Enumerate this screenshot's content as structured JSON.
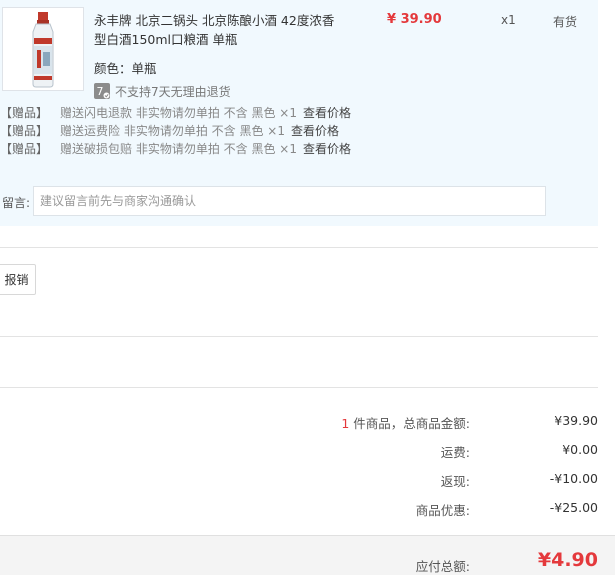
{
  "item": {
    "title": "永丰牌 北京二锅头 北京陈酿小酒 42度浓香型白酒150ml口粮酒 单瓶",
    "price": "¥ 39.90",
    "quantity": "x1",
    "stock": "有货",
    "color": "颜色：单瓶",
    "return_icon_text": "7",
    "return_policy": "不支持7天无理由退货"
  },
  "gifts": [
    {
      "tag": "【赠品】",
      "desc": "赠送闪电退款 非实物请勿单拍 不含 黑色 ×1",
      "link": "查看价格"
    },
    {
      "tag": "【赠品】",
      "desc": "赠送运费险 非实物请勿单拍 不含 黑色 ×1",
      "link": "查看价格"
    },
    {
      "tag": "【赠品】",
      "desc": "赠送破损包赔 非实物请勿单拍 不含 黑色 ×1",
      "link": "查看价格"
    }
  ],
  "note": {
    "label": "留言:",
    "placeholder": "建议留言前先与商家沟通确认"
  },
  "invoice": {
    "button_label": "报销"
  },
  "summary": {
    "count": "1",
    "count_suffix": " 件商品，总商品金额:",
    "goods_total": "¥39.90",
    "shipping_label": "运费:",
    "shipping": "¥0.00",
    "cashback_label": "返现:",
    "cashback": "-¥10.00",
    "discount_label": "商品优惠:",
    "discount": "-¥25.00",
    "payable_label": "应付总额:",
    "payable": "¥4.90"
  },
  "colors": {
    "accent": "#e4393c",
    "panel_bg": "#f1f9fe"
  }
}
